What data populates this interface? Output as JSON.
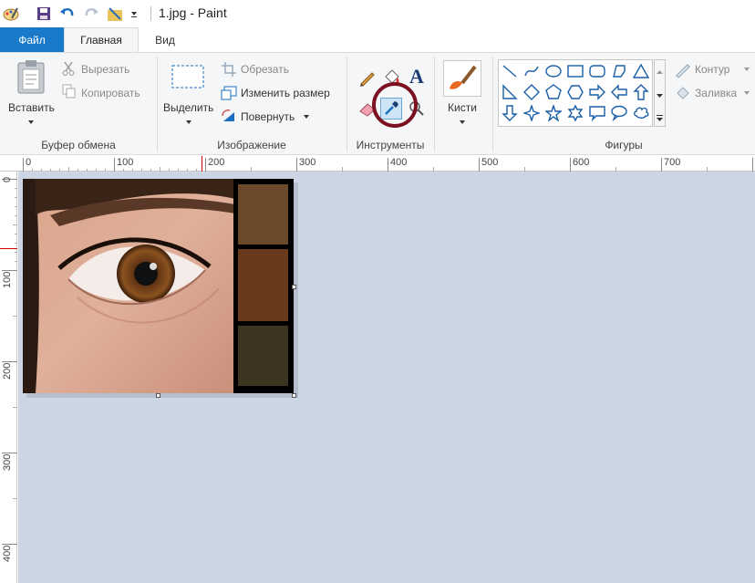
{
  "window": {
    "title": "1.jpg - Paint"
  },
  "tabs": {
    "file": "Файл",
    "home": "Главная",
    "view": "Вид"
  },
  "clipboard": {
    "paste": "Вставить",
    "cut": "Вырезать",
    "copy": "Копировать",
    "group_label": "Буфер обмена"
  },
  "image": {
    "select": "Выделить",
    "crop": "Обрезать",
    "resize": "Изменить размер",
    "rotate": "Повернуть",
    "group_label": "Изображение"
  },
  "tools": {
    "group_label": "Инструменты",
    "text_tool_glyph": "A"
  },
  "brushes": {
    "label": "Кисти"
  },
  "shapes": {
    "group_label": "Фигуры",
    "outline": "Контур",
    "fill": "Заливка"
  },
  "ruler": {
    "horizontal_ticks": [
      "0",
      "100",
      "200",
      "300",
      "400",
      "500",
      "600",
      "700"
    ],
    "vertical_ticks": [
      "0",
      "100",
      "200",
      "300",
      "400"
    ]
  },
  "palette_swatches": [
    "#6b4a2c",
    "#6a3a1c",
    "#3c3321"
  ],
  "colors": {
    "accent": "#1979ca",
    "workspace": "#cbd5e4",
    "eyedropper_highlight": "#7a1020"
  }
}
